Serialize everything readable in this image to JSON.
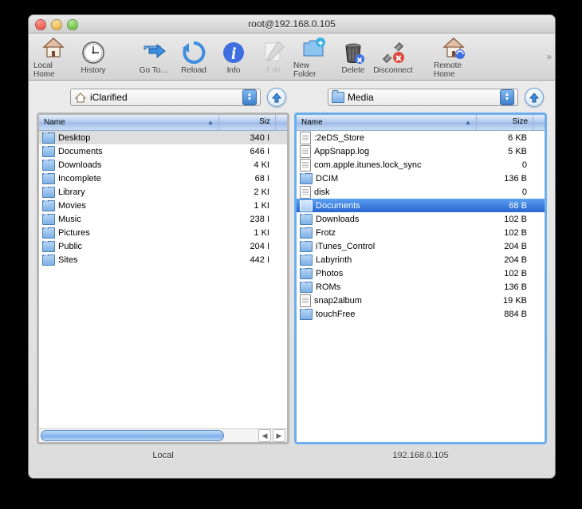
{
  "window": {
    "title": "root@192.168.0.105"
  },
  "toolbar": {
    "local_home": "Local Home",
    "history": "History",
    "goto": "Go To…",
    "reload": "Reload",
    "info": "Info",
    "edit": "Edit",
    "new_folder": "New Folder",
    "delete": "Delete",
    "disconnect": "Disconnect",
    "remote_home": "Remote Home"
  },
  "left": {
    "popup_label": "iClarified",
    "columns": {
      "name": "Name",
      "size": "Siz"
    },
    "pane_label": "Local",
    "selected_index": 0,
    "items": [
      {
        "name": "Desktop",
        "type": "folder",
        "size": "340 I"
      },
      {
        "name": "Documents",
        "type": "folder",
        "size": "646 I"
      },
      {
        "name": "Downloads",
        "type": "folder",
        "size": "4 KI"
      },
      {
        "name": "Incomplete",
        "type": "folder",
        "size": "68 I"
      },
      {
        "name": "Library",
        "type": "folder",
        "size": "2 KI"
      },
      {
        "name": "Movies",
        "type": "folder",
        "size": "1 KI"
      },
      {
        "name": "Music",
        "type": "folder",
        "size": "238 I"
      },
      {
        "name": "Pictures",
        "type": "folder",
        "size": "1 KI"
      },
      {
        "name": "Public",
        "type": "folder",
        "size": "204 I"
      },
      {
        "name": "Sites",
        "type": "folder",
        "size": "442 I"
      }
    ]
  },
  "right": {
    "popup_label": "Media",
    "columns": {
      "name": "Name",
      "size": "Size"
    },
    "pane_label": "192.168.0.105",
    "selected_index": 5,
    "items": [
      {
        "name": ":2eDS_Store",
        "type": "file",
        "size": "6 KB"
      },
      {
        "name": "AppSnapp.log",
        "type": "file",
        "size": "5 KB"
      },
      {
        "name": "com.apple.itunes.lock_sync",
        "type": "file",
        "size": "0"
      },
      {
        "name": "DCIM",
        "type": "folder",
        "size": "136 B"
      },
      {
        "name": "disk",
        "type": "file",
        "size": "0"
      },
      {
        "name": "Documents",
        "type": "folder",
        "size": "68 B"
      },
      {
        "name": "Downloads",
        "type": "folder",
        "size": "102 B"
      },
      {
        "name": "Frotz",
        "type": "folder",
        "size": "102 B"
      },
      {
        "name": "iTunes_Control",
        "type": "folder",
        "size": "204 B"
      },
      {
        "name": "Labyrinth",
        "type": "folder",
        "size": "204 B"
      },
      {
        "name": "Photos",
        "type": "folder",
        "size": "102 B"
      },
      {
        "name": "ROMs",
        "type": "folder",
        "size": "136 B"
      },
      {
        "name": "snap2album",
        "type": "file",
        "size": "19 KB"
      },
      {
        "name": "touchFree",
        "type": "folder",
        "size": "884 B"
      }
    ]
  }
}
